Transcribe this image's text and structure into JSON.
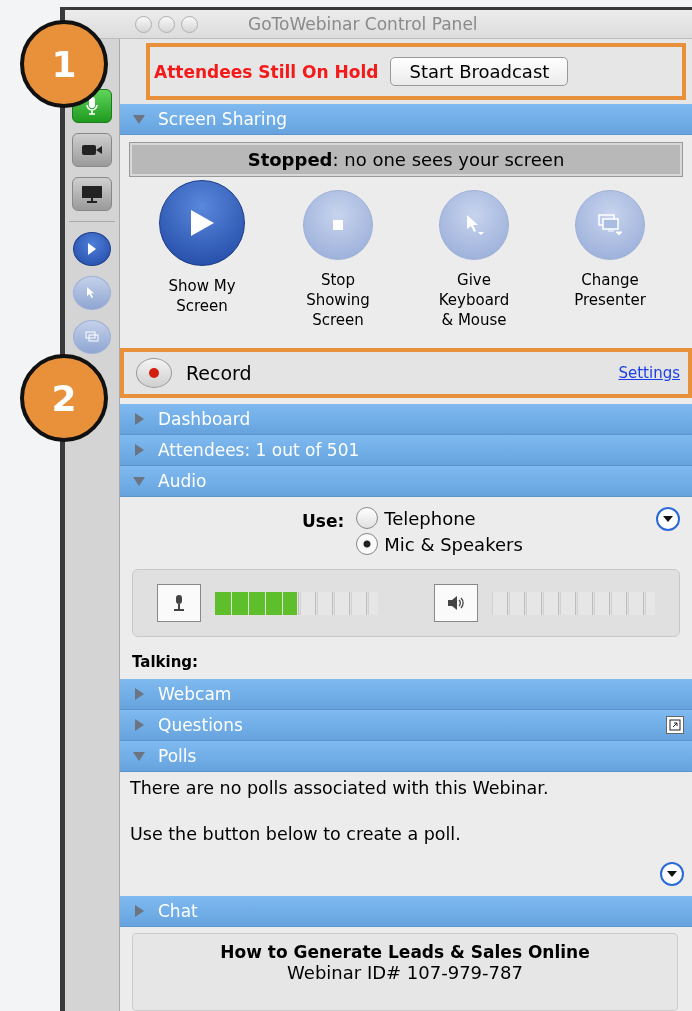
{
  "window": {
    "title": "GoToWebinar Control Panel"
  },
  "annotations": [
    {
      "label": "1"
    },
    {
      "label": "2"
    }
  ],
  "toolbar": [
    {
      "kind": "mic",
      "active": true
    },
    {
      "kind": "camera",
      "active": false
    },
    {
      "kind": "monitor",
      "active": false
    },
    {
      "kind": "play",
      "active": true
    },
    {
      "kind": "cursor",
      "active": false
    },
    {
      "kind": "screens",
      "active": false
    }
  ],
  "broadcast": {
    "status": "Attendees Still On Hold",
    "button": "Start Broadcast"
  },
  "panels": [
    {
      "kind": "screen_sharing",
      "title": "Screen Sharing",
      "expanded": true,
      "status": "**Stopped**: no one sees your screen",
      "actions": [
        {
          "kind": "play",
          "label": "Show My\nScreen",
          "enabled": true
        },
        {
          "kind": "stop",
          "label": "Stop\nShowing\nScreen",
          "enabled": false
        },
        {
          "kind": "cursor",
          "label": "Give\nKeyboard\n& Mouse",
          "enabled": false
        },
        {
          "kind": "screens",
          "label": "Change\nPresenter",
          "enabled": false
        }
      ]
    },
    {
      "kind": "record",
      "label": "Record",
      "link": "Settings"
    },
    {
      "kind": "plain",
      "title": "Dashboard",
      "expanded": false
    },
    {
      "kind": "plain",
      "title": "Attendees: 1 out of 501",
      "expanded": false
    },
    {
      "kind": "audio",
      "title": "Audio",
      "expanded": true,
      "use_label": "Use:",
      "options": [
        {
          "label": "Telephone",
          "selected": false
        },
        {
          "label": "Mic & Speakers",
          "selected": true
        }
      ],
      "mic": {
        "level": 0.5
      },
      "talking": "Talking:"
    },
    {
      "kind": "plain",
      "title": "Webcam",
      "expanded": false
    },
    {
      "kind": "plain",
      "title": "Questions",
      "expanded": false,
      "popout": true
    },
    {
      "kind": "polls",
      "title": "Polls",
      "expanded": true,
      "messages": [
        "There are no polls associated with this Webinar.",
        "Use the button below to create a poll."
      ]
    },
    {
      "kind": "plain",
      "title": "Chat",
      "expanded": false
    }
  ],
  "webinar": {
    "title": "How to Generate Leads & Sales Online",
    "id": "Webinar ID# 107-979-787"
  }
}
